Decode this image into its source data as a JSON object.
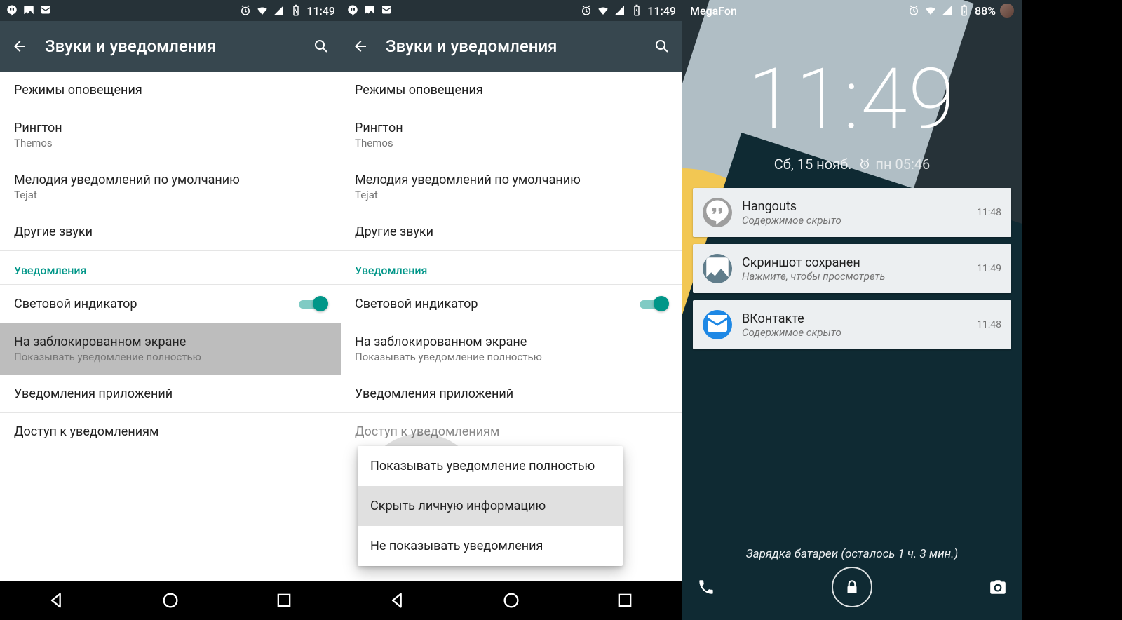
{
  "screens": {
    "a": {
      "status": {
        "time": "11:49"
      },
      "appbar": {
        "title": "Звуки и уведомления"
      },
      "items": [
        {
          "title": "Режимы оповещения"
        },
        {
          "title": "Рингтон",
          "sub": "Themos"
        },
        {
          "title": "Мелодия уведомлений по умолчанию",
          "sub": "Tejat"
        },
        {
          "title": "Другие звуки"
        }
      ],
      "section": "Уведомления",
      "led": {
        "title": "Световой индикатор"
      },
      "lock": {
        "title": "На заблокированном экране",
        "sub": "Показывать уведомление полностью"
      },
      "rest": [
        {
          "title": "Уведомления приложений"
        },
        {
          "title": "Доступ к уведомлениям"
        }
      ]
    },
    "b": {
      "menu": [
        "Показывать уведомление полностью",
        "Скрыть личную информацию",
        "Не показывать уведомления"
      ]
    },
    "c": {
      "carrier": "MegaFon",
      "battery": "88%",
      "time": "11:49",
      "date": "Сб, 15 нояб.",
      "alarm": "пн 05:46",
      "notifications": [
        {
          "icon": "hangouts",
          "title": "Hangouts",
          "sub": "Содержимое скрыто",
          "time": "11:48",
          "badge": "gray"
        },
        {
          "icon": "image",
          "title": "Скриншот сохранен",
          "sub": "Нажмите, чтобы просмотреть",
          "time": "11:49",
          "badge": "blue-gray"
        },
        {
          "icon": "mail",
          "title": "ВКонтакте",
          "sub": "Содержимое скрыто",
          "time": "11:48",
          "badge": "blue"
        }
      ],
      "charging": "Зарядка батареи (осталось 1 ч. 3 мин.)"
    }
  }
}
